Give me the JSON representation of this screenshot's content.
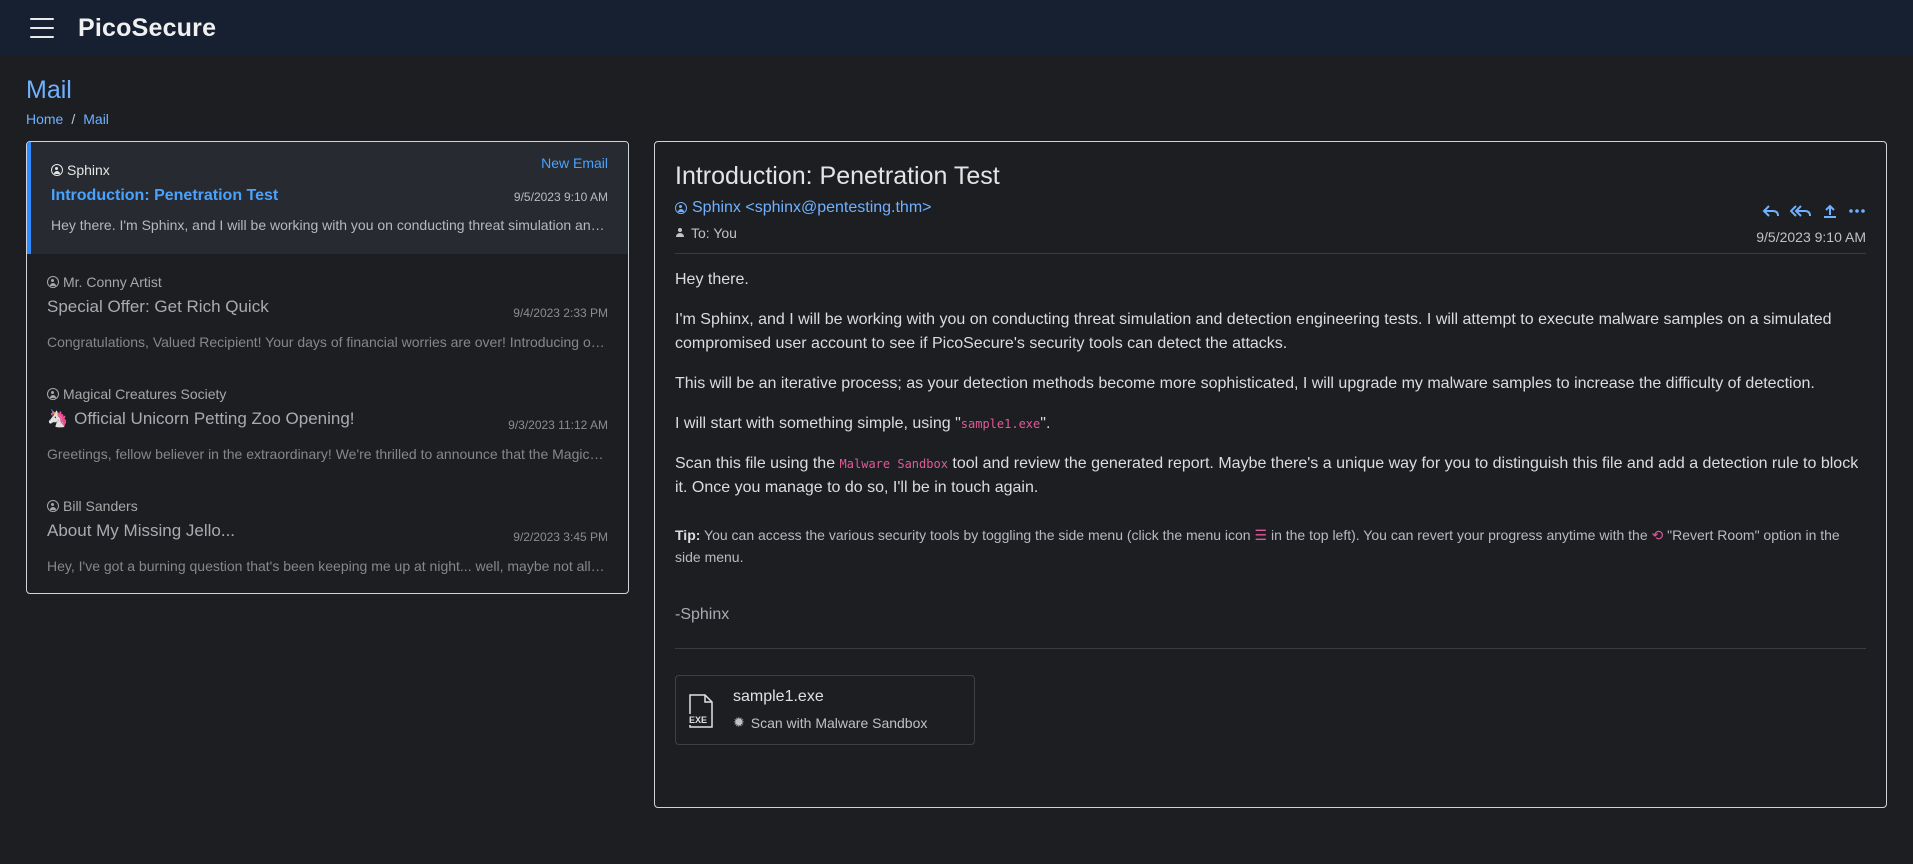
{
  "app": {
    "brand": "PicoSecure"
  },
  "page": {
    "title": "Mail",
    "breadcrumb": [
      "Home",
      "Mail"
    ]
  },
  "mail_list": {
    "new_email_label": "New Email",
    "items": [
      {
        "sender": "Sphinx",
        "subject": "Introduction: Penetration Test",
        "date": "9/5/2023 9:10 AM",
        "preview": "Hey there. I'm Sphinx, and I will be working with you on conducting threat simulation and detection engineering tests.",
        "active": true
      },
      {
        "sender": "Mr. Conny Artist",
        "subject": "Special Offer: Get Rich Quick",
        "date": "9/4/2023 2:33 PM",
        "preview": "Congratulations, Valued Recipient! Your days of financial worries are over! Introducing our exclusive program"
      },
      {
        "sender": "Magical Creatures Society",
        "subject": "Official Unicorn Petting Zoo Opening!",
        "emoji": "🦄",
        "date": "9/3/2023 11:12 AM",
        "preview": "Greetings, fellow believer in the extraordinary! We're thrilled to announce that the Magical Creatures Society"
      },
      {
        "sender": "Bill Sanders",
        "subject": "About My Missing Jello...",
        "date": "9/2/2023 3:45 PM",
        "preview": "Hey, I've got a burning question that's been keeping me up at night... well, maybe not all night"
      }
    ]
  },
  "reader": {
    "subject": "Introduction: Penetration Test",
    "from": "Sphinx <sphinx@pentesting.thm>",
    "to": "To: You",
    "date": "9/5/2023 9:10 AM",
    "body": {
      "greeting": "Hey there.",
      "p1": "I'm Sphinx, and I will be working with you on conducting threat simulation and detection engineering tests. I will attempt to execute malware samples on a simulated compromised user account to see if PicoSecure's security tools can detect the attacks.",
      "p2": "This will be an iterative process; as your detection methods become more sophisticated, I will upgrade my malware samples to increase the difficulty of detection.",
      "p3_pre": "I will start with something simple, using \"",
      "p3_code": "sample1.exe",
      "p3_post": "\".",
      "p4_pre": "Scan this file using the ",
      "p4_code": "Malware Sandbox",
      "p4_post": " tool and review the generated report. Maybe there's a unique way for you to distinguish this file and add a detection rule to block it. Once you manage to do so, I'll be in touch again."
    },
    "tip": {
      "label": "Tip:",
      "part1": " You can access the various security tools by toggling the side menu (click the menu icon ",
      "part2": " in the top left). You can revert your progress anytime with the ",
      "part3": " \"Revert Room\" option in the side menu."
    },
    "signature": "-Sphinx",
    "attachment": {
      "name": "sample1.exe",
      "file_label": "EXE",
      "action": "Scan with Malware Sandbox"
    },
    "actions": [
      "reply-icon",
      "reply-all-icon",
      "forward-icon",
      "more-icon"
    ]
  },
  "colors": {
    "accent": "#4aa2ff",
    "code": "#e05a9a",
    "topbar": "#172031",
    "background": "#1d1e22"
  }
}
